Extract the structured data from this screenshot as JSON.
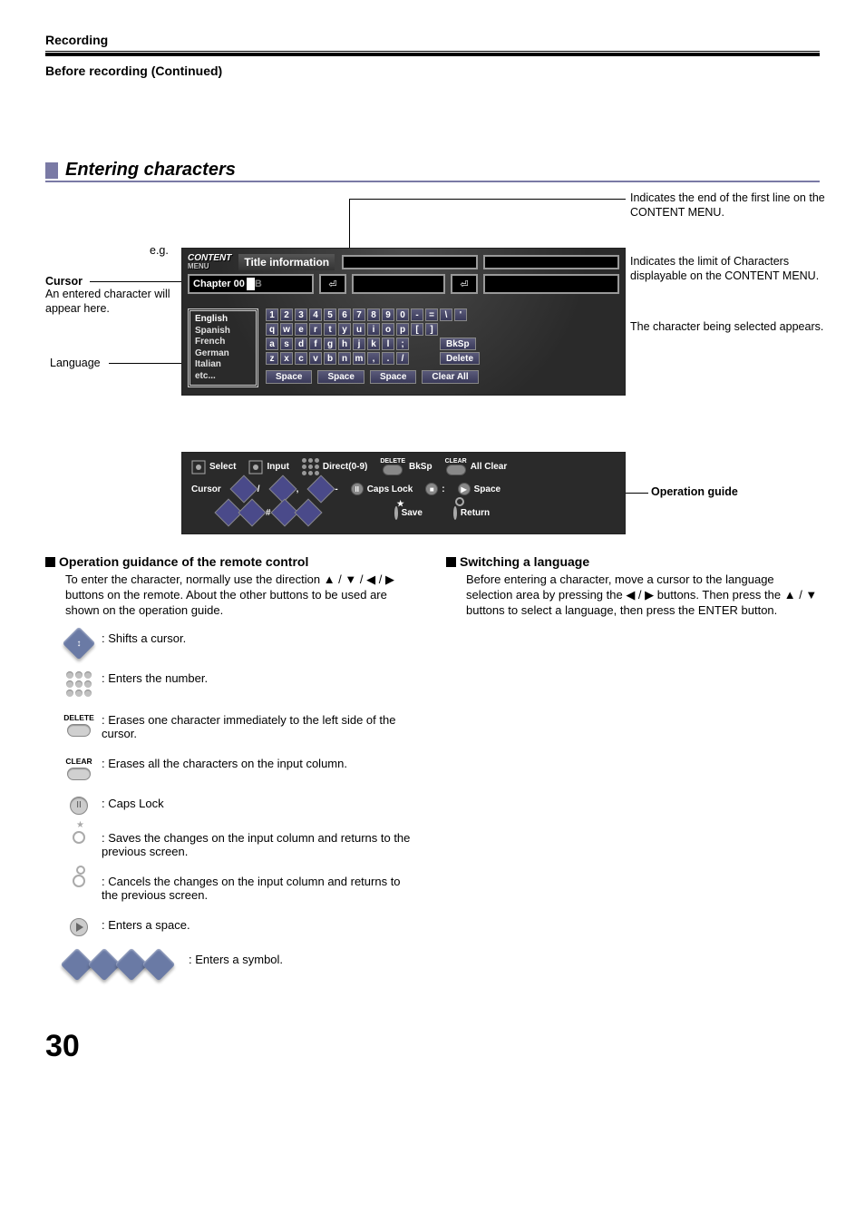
{
  "header": {
    "category": "Recording",
    "subhead": "Before recording (Continued)",
    "section_title": "Entering characters"
  },
  "annotations": {
    "eg": "e.g.",
    "cursor_title": "Cursor",
    "cursor_desc": "An entered character will appear here.",
    "language_label": "Language",
    "end_line": "Indicates the end of the first line on the CONTENT MENU.",
    "limit": "Indicates the limit of Characters displayable on the CONTENT MENU.",
    "selected": "The character being selected appears.",
    "op_guide": "Operation guide"
  },
  "osd": {
    "logo_top": "CONTENT",
    "logo_sub": "MENU",
    "title": "Title information",
    "chapter_prefix": "Chapter 00",
    "chapter_char": "B",
    "languages": [
      "English",
      "Spanish",
      "French",
      "German",
      "Italian",
      "etc..."
    ],
    "kb_rows": [
      [
        "1",
        "2",
        "3",
        "4",
        "5",
        "6",
        "7",
        "8",
        "9",
        "0",
        "-",
        "=",
        "\\",
        "'"
      ],
      [
        "q",
        "w",
        "e",
        "r",
        "t",
        "y",
        "u",
        "i",
        "o",
        "p",
        "[",
        "]"
      ],
      [
        "a",
        "s",
        "d",
        "f",
        "g",
        "h",
        "j",
        "k",
        "l",
        ";"
      ],
      [
        "z",
        "x",
        "c",
        "v",
        "b",
        "n",
        "m",
        ",",
        ".",
        "/"
      ]
    ],
    "bksp": "BkSp",
    "delete": "Delete",
    "space": "Space",
    "clear_all": "Clear All"
  },
  "guide": {
    "select": "Select",
    "input": "Input",
    "direct": "Direct(0-9)",
    "delete_label": "DELETE",
    "bksp": "BkSp",
    "clear_label": "CLEAR",
    "all_clear": "All Clear",
    "cursor": "Cursor",
    "slash": "/",
    "comma": ",",
    "dash": "-",
    "hash": "#",
    "caps_lock": "Caps Lock",
    "colon": ":",
    "space": "Space",
    "save": "Save",
    "return": "Return"
  },
  "left_col": {
    "heading": "Operation guidance of the remote control",
    "intro": "To enter the character, normally use the direction ▲ / ▼ / ◀ / ▶ buttons on the remote. About the other buttons to be used are shown on the operation guide.",
    "shift_cursor": ": Shifts a cursor.",
    "enter_number": ": Enters the number.",
    "delete_label": "DELETE",
    "erase_one": ": Erases one character immediately to the left side of the cursor.",
    "clear_label": "CLEAR",
    "erase_all": ": Erases all the characters on the input column.",
    "caps_lock": ": Caps Lock",
    "save": ": Saves the changes on the input column and returns to the previous screen.",
    "cancel": ": Cancels the changes on the input column and returns to the previous screen.",
    "enter_space": ": Enters a space.",
    "enter_symbol": ": Enters a symbol."
  },
  "right_col": {
    "heading": "Switching a language",
    "body": "Before entering a character, move a cursor to the language selection area by pressing the ◀ / ▶ buttons. Then press the ▲ / ▼ buttons to select a language, then press the ENTER button."
  },
  "page_number": "30"
}
